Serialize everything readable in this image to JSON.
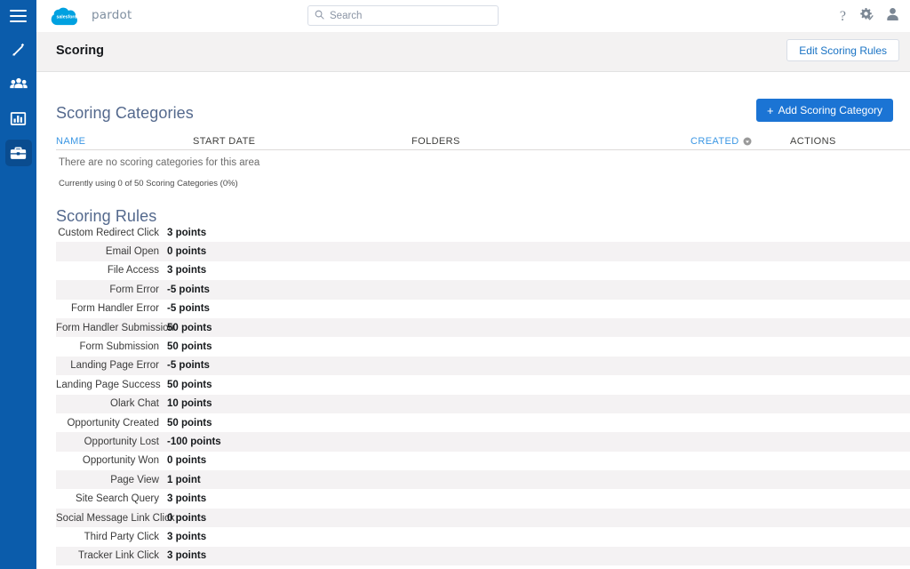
{
  "colors": {
    "rail_blue": "#0b5cab",
    "rail_active": "#0a4c8f",
    "accent_blue": "#1b74d4",
    "link_blue": "#3b97e4",
    "heading_slate": "#54698d",
    "row_stripe": "#f4f2f3",
    "header_strip": "#f3f2f2"
  },
  "rail": {
    "menu_icon": "hamburger-icon",
    "items": [
      {
        "name": "marketing",
        "icon": "wand-icon",
        "active": false
      },
      {
        "name": "prospects",
        "icon": "people-group-icon",
        "active": false
      },
      {
        "name": "reports",
        "icon": "bar-chart-icon",
        "active": false
      },
      {
        "name": "admin",
        "icon": "briefcase-icon",
        "active": true
      }
    ]
  },
  "topbar": {
    "brand_logo": "salesforce-cloud-logo",
    "brand_logo_text": "salesforce",
    "brand_name": "pardot",
    "search": {
      "icon": "search-icon",
      "placeholder": "Search",
      "value": ""
    },
    "actions": [
      {
        "name": "help",
        "icon": "question-mark-icon",
        "glyph": "?"
      },
      {
        "name": "setup",
        "icon": "gear-icon"
      },
      {
        "name": "user-profile",
        "icon": "person-icon"
      }
    ]
  },
  "page_header": {
    "title": "Scoring",
    "edit_button": "Edit Scoring Rules"
  },
  "categories": {
    "title": "Scoring Categories",
    "add_button": "Add Scoring Category",
    "add_button_plus": "+",
    "columns": [
      {
        "label": "NAME",
        "link": true
      },
      {
        "label": "START DATE",
        "link": false
      },
      {
        "label": "FOLDERS",
        "link": false
      },
      {
        "label": "CREATED",
        "link": true,
        "sort_icon": "sort-circle-icon"
      },
      {
        "label": "ACTIONS",
        "link": false
      }
    ],
    "empty_message": "There are no scoring categories for this area",
    "usage_message": "Currently using 0 of 50 Scoring Categories (0%)"
  },
  "rules": {
    "title": "Scoring Rules",
    "items": [
      {
        "label": "Custom Redirect Click",
        "value": "3 points"
      },
      {
        "label": "Email Open",
        "value": "0 points"
      },
      {
        "label": "File Access",
        "value": "3 points"
      },
      {
        "label": "Form Error",
        "value": "-5 points"
      },
      {
        "label": "Form Handler Error",
        "value": "-5 points"
      },
      {
        "label": "Form Handler Submission",
        "value": "50 points"
      },
      {
        "label": "Form Submission",
        "value": "50 points"
      },
      {
        "label": "Landing Page Error",
        "value": "-5 points"
      },
      {
        "label": "Landing Page Success",
        "value": "50 points"
      },
      {
        "label": "Olark Chat",
        "value": "10 points"
      },
      {
        "label": "Opportunity Created",
        "value": "50 points"
      },
      {
        "label": "Opportunity Lost",
        "value": "-100 points"
      },
      {
        "label": "Opportunity Won",
        "value": "0 points"
      },
      {
        "label": "Page View",
        "value": "1 point"
      },
      {
        "label": "Site Search Query",
        "value": "3 points"
      },
      {
        "label": "Social Message Link Click",
        "value": "0 points"
      },
      {
        "label": "Third Party Click",
        "value": "3 points"
      },
      {
        "label": "Tracker Link Click",
        "value": "3 points"
      }
    ]
  }
}
